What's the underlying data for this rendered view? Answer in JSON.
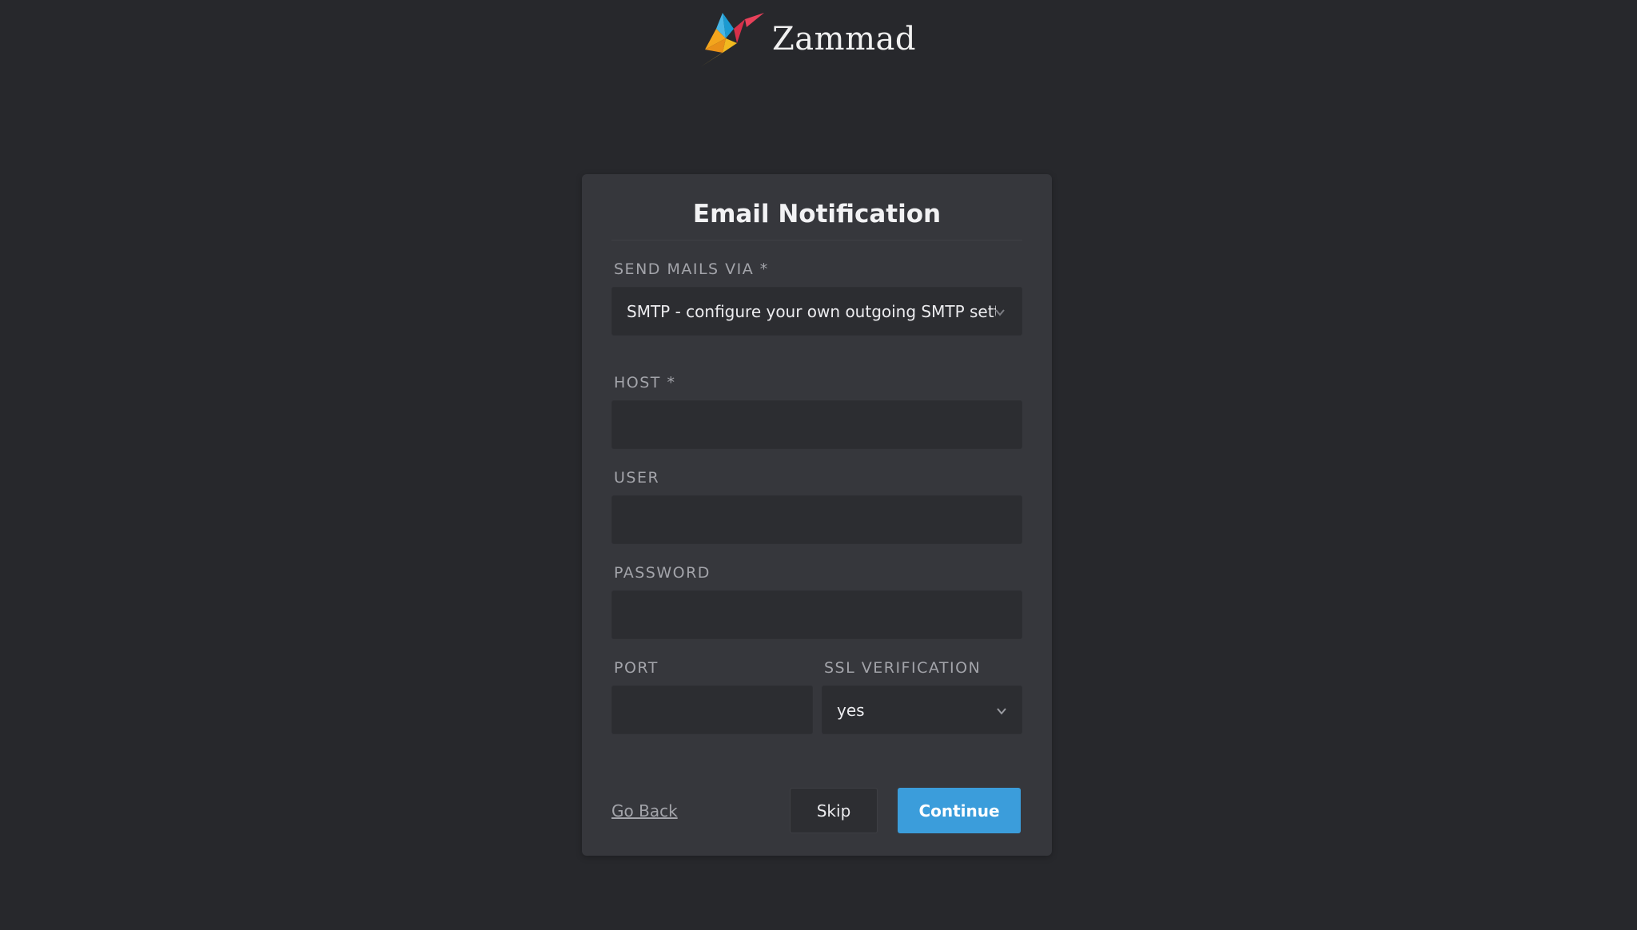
{
  "brand": {
    "name": "Zammad",
    "logo_icon": "zammad-bird-icon"
  },
  "form": {
    "title": "Email Notification",
    "send_mails_via": {
      "label": "SEND MAILS VIA *",
      "selected": "SMTP - configure your own outgoing SMTP settings"
    },
    "host": {
      "label": "HOST *",
      "value": ""
    },
    "user": {
      "label": "USER",
      "value": ""
    },
    "password": {
      "label": "PASSWORD",
      "value": ""
    },
    "port": {
      "label": "PORT",
      "value": ""
    },
    "ssl_verification": {
      "label": "SSL VERIFICATION",
      "selected": "yes"
    }
  },
  "actions": {
    "go_back": "Go Back",
    "skip": "Skip",
    "continue": "Continue"
  },
  "colors": {
    "background": "#27282c",
    "card": "#36373c",
    "input": "#2c2d31",
    "primary": "#3b9ddb",
    "label": "#a3a4aa"
  }
}
